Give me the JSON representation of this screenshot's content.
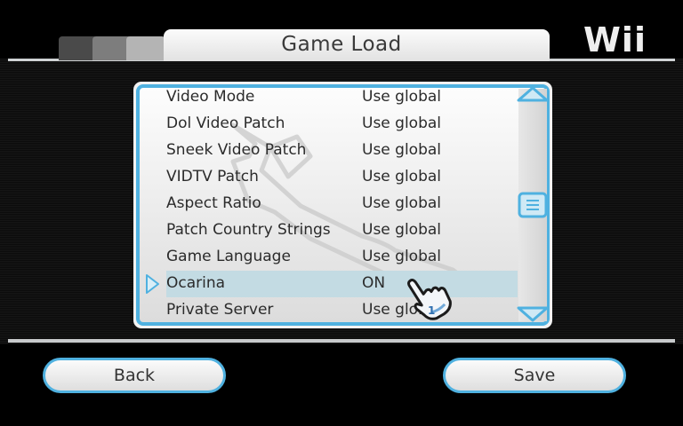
{
  "header": {
    "title": "Game Load",
    "brand_logo": "Wii"
  },
  "settings": {
    "rows": [
      {
        "label": "Video Mode",
        "value": "Use global"
      },
      {
        "label": "Dol Video Patch",
        "value": "Use global"
      },
      {
        "label": "Sneek Video Patch",
        "value": "Use global"
      },
      {
        "label": "VIDTV Patch",
        "value": "Use global"
      },
      {
        "label": "Aspect Ratio",
        "value": "Use global"
      },
      {
        "label": "Patch Country Strings",
        "value": "Use global"
      },
      {
        "label": "Game Language",
        "value": "Use global"
      },
      {
        "label": "Ocarina",
        "value": "ON"
      },
      {
        "label": "Private Server",
        "value": "Use global"
      }
    ],
    "selected_index": 7
  },
  "pointer": {
    "player_number": "1"
  },
  "buttons": {
    "back_label": "Back",
    "save_label": "Save"
  },
  "colors": {
    "accent": "#4fb1e0",
    "selection": "#c3dbe3",
    "background": "#000000"
  },
  "icons": {
    "back_scroll_up": "triangle-up-icon",
    "scroll_down": "triangle-down-icon",
    "scroll_thumb": "grip-icon",
    "selector": "triangle-right-icon",
    "watermark": "wrench-icon",
    "pointer": "hand-pointer-icon"
  }
}
